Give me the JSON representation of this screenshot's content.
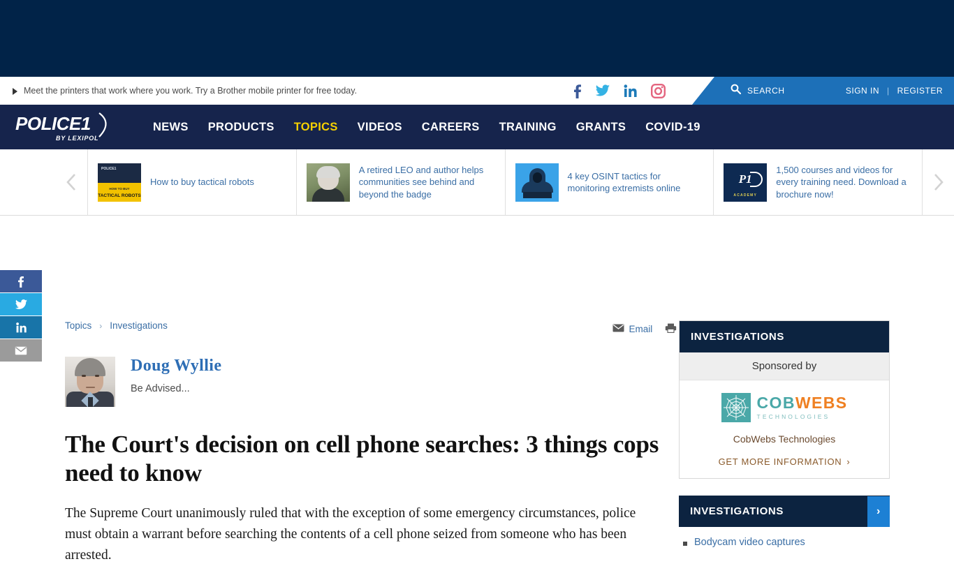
{
  "promo": {
    "text": "Meet the printers that work where you work. Try a Brother mobile printer for free today."
  },
  "social": [
    {
      "name": "facebook",
      "color": "#3b5998"
    },
    {
      "name": "twitter",
      "color": "#34b2e4"
    },
    {
      "name": "linkedin",
      "color": "#1d7bb9"
    },
    {
      "name": "instagram",
      "color": "#e4657f"
    }
  ],
  "search": {
    "label": "SEARCH"
  },
  "auth": {
    "sign_in": "SIGN IN",
    "separator": "|",
    "register": "REGISTER"
  },
  "brand": {
    "name": "POLICE1",
    "tagline": "BY LEXIPOL"
  },
  "nav": {
    "items": [
      {
        "label": "NEWS",
        "active": false
      },
      {
        "label": "PRODUCTS",
        "active": false
      },
      {
        "label": "TOPICS",
        "active": true
      },
      {
        "label": "VIDEOS",
        "active": false
      },
      {
        "label": "CAREERS",
        "active": false
      },
      {
        "label": "TRAINING",
        "active": false
      },
      {
        "label": "GRANTS",
        "active": false
      },
      {
        "label": "COVID-19",
        "active": false
      }
    ],
    "active_color": "#f5d000"
  },
  "carousel": {
    "prev": "‹",
    "next": "›",
    "items": [
      {
        "title": "How to buy tactical robots",
        "thumb": "tactical-robots-cover",
        "thumb_line1": "HOW TO BUY",
        "thumb_line2": "TACTICAL ROBOTS",
        "thumb_badge": "POLICE1"
      },
      {
        "title": "A retired LEO and author helps communities see behind and beyond the badge",
        "thumb": "woman-portrait"
      },
      {
        "title": "4 key OSINT tactics for monitoring extremists online",
        "thumb": "hooded-figure-laptop"
      },
      {
        "title": "1,500 courses and videos for every training need. Download a brochure now!",
        "thumb": "p1-academy-logo",
        "thumb_line1": "P1",
        "thumb_line2": "ACADEMY"
      }
    ]
  },
  "share_rail": [
    {
      "name": "facebook",
      "color": "#3b5998"
    },
    {
      "name": "twitter",
      "color": "#29aae2"
    },
    {
      "name": "linkedin",
      "color": "#1874a8"
    },
    {
      "name": "email",
      "color": "#9b9b9b"
    }
  ],
  "article": {
    "breadcrumb": {
      "topics": "Topics",
      "separator": "›",
      "category": "Investigations"
    },
    "actions": {
      "email": "Email",
      "print": "Print"
    },
    "author": {
      "name": "Doug Wyllie",
      "tagline": "Be Advised..."
    },
    "headline": "The Court's decision on cell phone searches: 3 things cops need to know",
    "summary": "The Supreme Court unanimously ruled that with the exception of some emergency circumstances, police must obtain a warrant before searching the contents of a cell phone seized from someone who has been arrested."
  },
  "sidebar": {
    "sponsor_widget": {
      "title": "INVESTIGATIONS",
      "sponsored_label": "Sponsored by",
      "logo_part1": "COB",
      "logo_part2": "WEBS",
      "logo_sub": "TECHNOLOGIES",
      "company": "CobWebs Technologies",
      "cta": "GET MORE INFORMATION",
      "cta_arrow": "›"
    },
    "topics_widget": {
      "title": "INVESTIGATIONS",
      "chevron": "›",
      "items": [
        {
          "label": "Bodycam video captures"
        }
      ]
    }
  }
}
